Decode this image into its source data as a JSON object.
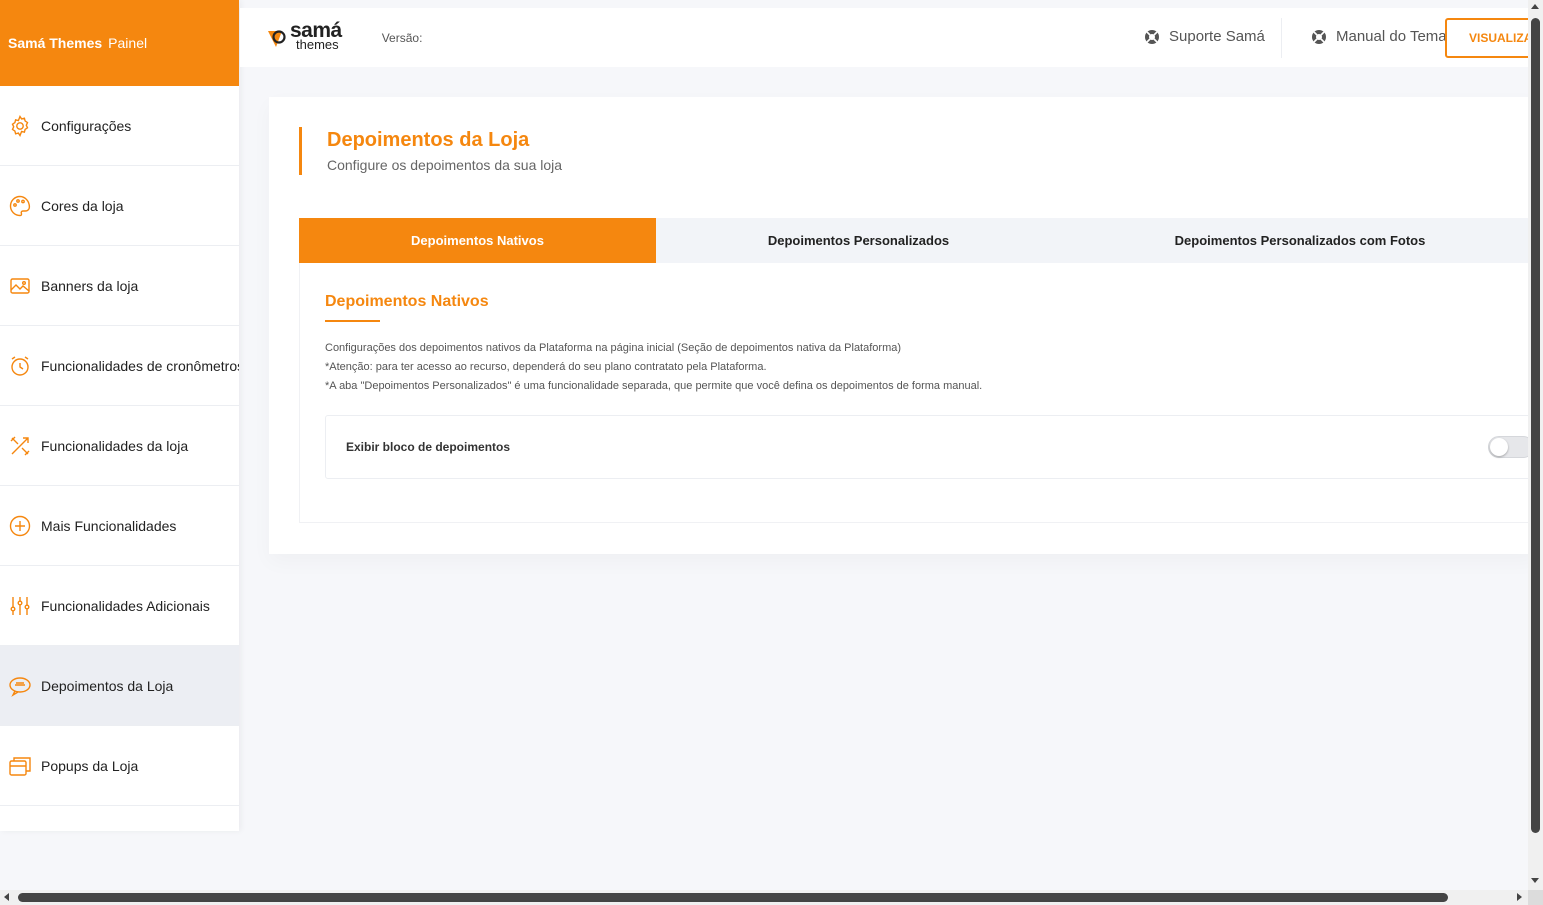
{
  "brand": {
    "name": "Samá Themes",
    "suffix": "Painel",
    "color": "#f5870f"
  },
  "sidebar": {
    "items": [
      {
        "label": "Configurações",
        "icon": "gear-icon"
      },
      {
        "label": "Cores da loja",
        "icon": "palette-icon"
      },
      {
        "label": "Banners da loja",
        "icon": "image-icon"
      },
      {
        "label": "Funcionalidades de cronômetros",
        "icon": "alarm-clock-icon"
      },
      {
        "label": "Funcionalidades da loja",
        "icon": "tools-icon"
      },
      {
        "label": "Mais Funcionalidades",
        "icon": "plus-circle-icon"
      },
      {
        "label": "Funcionalidades Adicionais",
        "icon": "sliders-icon"
      },
      {
        "label": "Depoimentos da Loja",
        "icon": "chat-icon",
        "active": true
      },
      {
        "label": "Popups da Loja",
        "icon": "popup-window-icon"
      }
    ]
  },
  "topbar": {
    "logo_word1": "samá",
    "logo_word2": "themes",
    "version_label": "Versão:",
    "support_label": "Suporte Samá",
    "manual_label": "Manual do Tema",
    "preview_label": "VISUALIZAR"
  },
  "page": {
    "title": "Depoimentos da Loja",
    "subtitle": "Configure os depoimentos da sua loja"
  },
  "tabs": [
    {
      "label": "Depoimentos Nativos",
      "active": true
    },
    {
      "label": "Depoimentos Personalizados",
      "active": false
    },
    {
      "label": "Depoimentos Personalizados com Fotos",
      "active": false
    }
  ],
  "section": {
    "title": "Depoimentos Nativos",
    "desc_line1": "Configurações dos depoimentos nativos da Plataforma na página inicial (Seção de depoimentos nativa da Plataforma)",
    "desc_line2": "*Atenção: para ter acesso ao recurso, dependerá do seu plano contratato pela Plataforma.",
    "desc_line3": "*A aba \"Depoimentos Personalizados\" é uma funcionalidade separada, que permite que você defina os depoimentos de forma manual.",
    "option_label": "Exibir bloco de depoimentos",
    "option_enabled": false
  }
}
